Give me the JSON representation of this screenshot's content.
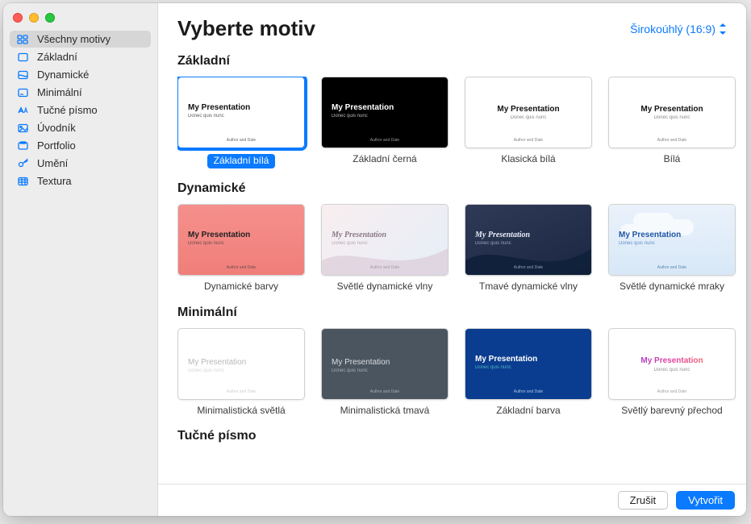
{
  "sidebar": {
    "items": [
      {
        "icon": "grid",
        "label": "Všechny motivy",
        "active": true
      },
      {
        "icon": "square",
        "label": "Základní",
        "active": false
      },
      {
        "icon": "wave",
        "label": "Dynamické",
        "active": false
      },
      {
        "icon": "minimal",
        "label": "Minimální",
        "active": false
      },
      {
        "icon": "bold",
        "label": "Tučné písmo",
        "active": false
      },
      {
        "icon": "photo",
        "label": "Úvodník",
        "active": false
      },
      {
        "icon": "folder",
        "label": "Portfolio",
        "active": false
      },
      {
        "icon": "art",
        "label": "Umění",
        "active": false
      },
      {
        "icon": "texture",
        "label": "Textura",
        "active": false
      }
    ]
  },
  "header": {
    "title": "Vyberte motiv",
    "aspect_label": "Širokoúhlý (16:9)"
  },
  "thumb_text": {
    "title": "My Presentation",
    "subtitle": "Donec quis nunc",
    "footer": "Author and Date"
  },
  "sections": [
    {
      "heading": "Základní",
      "themes": [
        {
          "label": "Základní bílá",
          "selected": true,
          "style": "white-left"
        },
        {
          "label": "Základní černá",
          "selected": false,
          "style": "black-left"
        },
        {
          "label": "Klasická bílá",
          "selected": false,
          "style": "white-center"
        },
        {
          "label": "Bílá",
          "selected": false,
          "style": "white-center"
        }
      ],
      "peek": "white"
    },
    {
      "heading": "Dynamické",
      "themes": [
        {
          "label": "Dynamické barvy",
          "selected": false,
          "style": "dyn-red"
        },
        {
          "label": "Světlé dynamické vlny",
          "selected": false,
          "style": "dyn-light"
        },
        {
          "label": "Tmavé dynamické vlny",
          "selected": false,
          "style": "dyn-dark"
        },
        {
          "label": "Světlé dynamické mraky",
          "selected": false,
          "style": "dyn-clouds"
        }
      ],
      "peek": "dyn-purple"
    },
    {
      "heading": "Minimální",
      "themes": [
        {
          "label": "Minimalistická světlá",
          "selected": false,
          "style": "min-light"
        },
        {
          "label": "Minimalistická tmavá",
          "selected": false,
          "style": "min-dark"
        },
        {
          "label": "Základní barva",
          "selected": false,
          "style": "min-blue"
        },
        {
          "label": "Světlý barevný přechod",
          "selected": false,
          "style": "min-grad"
        }
      ],
      "peek": "white"
    },
    {
      "heading": "Tučné písmo",
      "themes": [],
      "peek": null
    }
  ],
  "footer": {
    "cancel": "Zrušit",
    "create": "Vytvořit"
  },
  "colors": {
    "accent": "#0a7aff"
  }
}
